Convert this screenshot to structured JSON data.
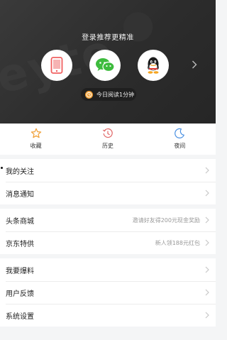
{
  "header": {
    "login_title": "登录推荐更精准",
    "read_time": "今日阅读1分钟",
    "watermark": "eyte",
    "login_options": [
      {
        "icon": "phone-icon",
        "color": "#f06060"
      },
      {
        "icon": "wechat-icon",
        "color": "#3dbb3d"
      },
      {
        "icon": "qq-icon",
        "color": "#222222"
      }
    ]
  },
  "quick": {
    "items": [
      {
        "label": "收藏",
        "icon": "star-icon",
        "color": "#f0a037"
      },
      {
        "label": "历史",
        "icon": "history-icon",
        "color": "#e06666"
      },
      {
        "label": "夜间",
        "icon": "moon-icon",
        "color": "#4a90e2"
      }
    ]
  },
  "menu": {
    "group1": [
      {
        "label": "我的关注"
      },
      {
        "label": "消息通知"
      }
    ],
    "group2": [
      {
        "label": "头条商城",
        "hint": "邀请好友得200元现金奖励"
      },
      {
        "label": "京东特供",
        "hint": "新人领188元红包"
      }
    ],
    "group3": [
      {
        "label": "我要爆料"
      },
      {
        "label": "用户反馈"
      },
      {
        "label": "系统设置"
      }
    ]
  },
  "colors": {
    "header_bg": "#2f2f2f",
    "accent_orange": "#f0a037",
    "chevron": "#c8c8c8"
  }
}
